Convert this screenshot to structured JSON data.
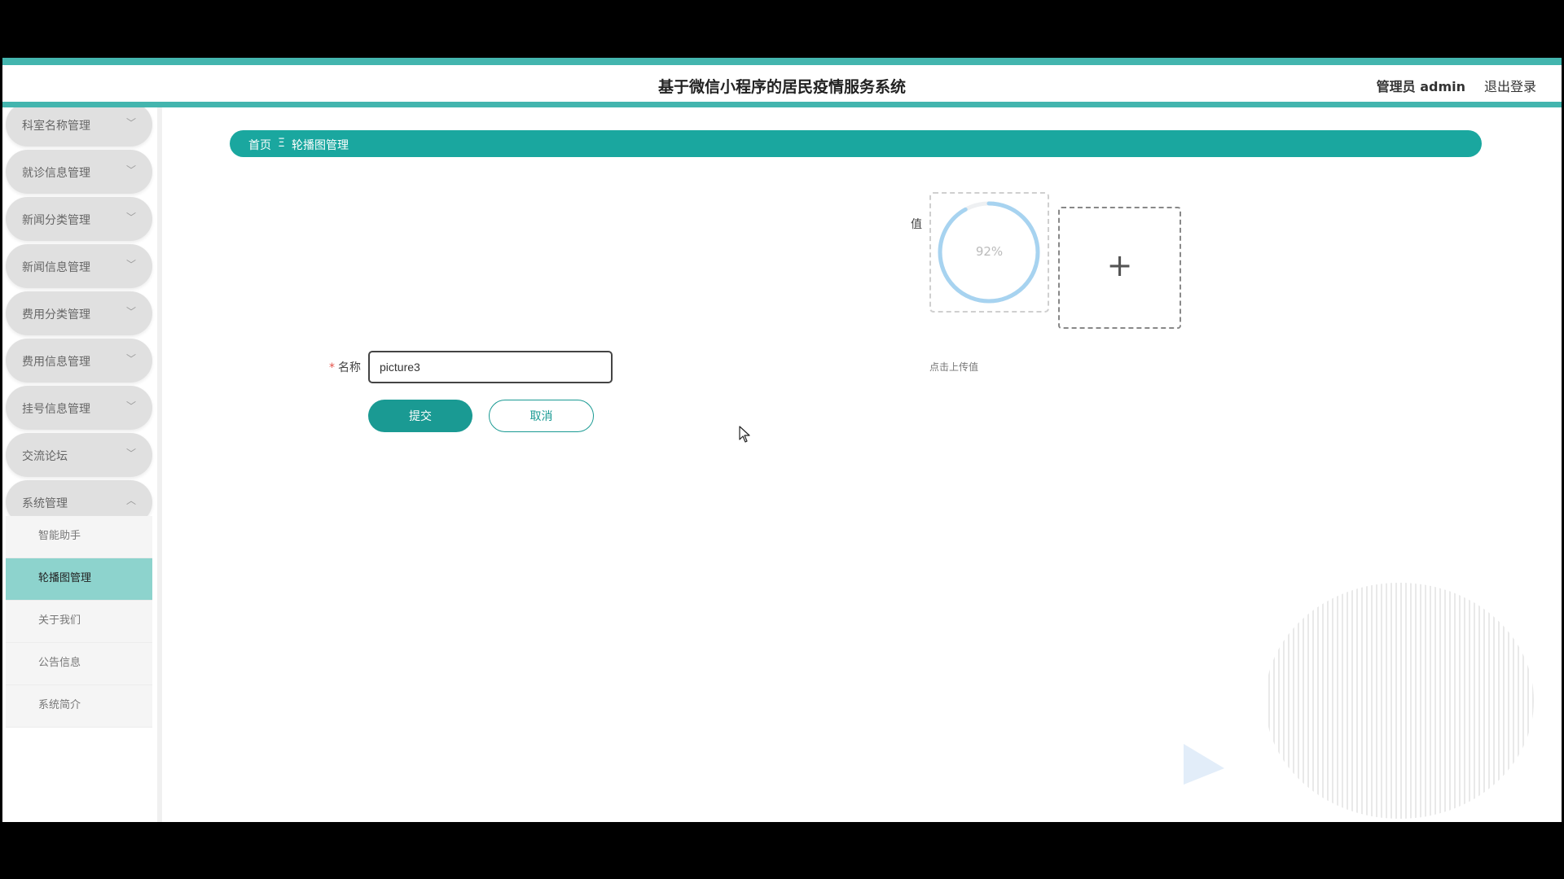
{
  "header": {
    "title": "基于微信小程序的居民疫情服务系统",
    "user": "管理员 admin",
    "logout": "退出登录"
  },
  "sidebar": {
    "items": [
      {
        "label": "科室名称管理"
      },
      {
        "label": "就诊信息管理"
      },
      {
        "label": "新闻分类管理"
      },
      {
        "label": "新闻信息管理"
      },
      {
        "label": "费用分类管理"
      },
      {
        "label": "费用信息管理"
      },
      {
        "label": "挂号信息管理"
      },
      {
        "label": "交流论坛"
      },
      {
        "label": "系统管理"
      }
    ],
    "submenu": [
      {
        "label": "智能助手"
      },
      {
        "label": "轮播图管理",
        "active": true
      },
      {
        "label": "关于我们"
      },
      {
        "label": "公告信息"
      },
      {
        "label": "系统简介"
      }
    ]
  },
  "breadcrumb": {
    "home": "首页",
    "separator": "Ξ",
    "current": "轮播图管理"
  },
  "form": {
    "value_label": "值",
    "upload_progress": 92,
    "upload_progress_text": "92%",
    "upload_hint": "点击上传值",
    "name_label": "名称",
    "name_value": "picture3",
    "submit_label": "提交",
    "cancel_label": "取消"
  },
  "colors": {
    "accent": "#1aa79f",
    "stripe": "#43b5ae",
    "active_submenu": "#8dd3cd",
    "progress": "#a7d3f0"
  }
}
